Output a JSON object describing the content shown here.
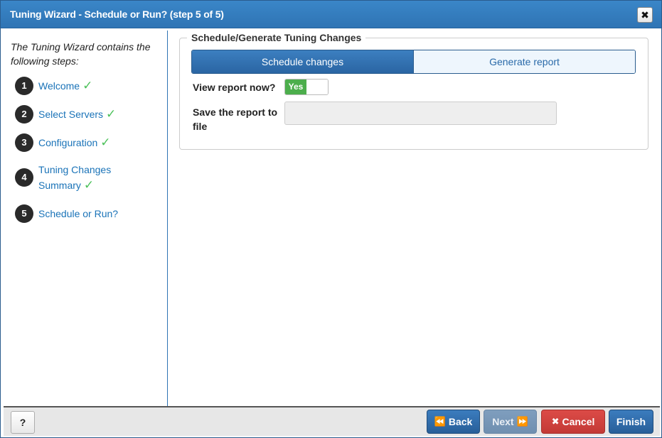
{
  "window": {
    "title": "Tuning Wizard - Schedule or Run? (step 5 of 5)",
    "close_icon": "close-icon",
    "close_glyph": "✖"
  },
  "sidebar": {
    "intro": "The Tuning Wizard contains the following steps:",
    "steps": [
      {
        "number": "1",
        "label": "Welcome",
        "check": "✓"
      },
      {
        "number": "2",
        "label": "Select Servers",
        "check": "✓"
      },
      {
        "number": "3",
        "label": "Configuration",
        "check": "✓"
      },
      {
        "number": "4",
        "label_line1": "Tuning Changes",
        "label_line2": "Summary",
        "check": "✓"
      },
      {
        "number": "5",
        "label": "Schedule or Run?"
      }
    ]
  },
  "main": {
    "legend": "Schedule/Generate Tuning Changes",
    "segments": [
      {
        "label": "Schedule changes",
        "active": true
      },
      {
        "label": "Generate report",
        "active": false
      }
    ],
    "view_report_label": "View report now?",
    "view_report_toggle": "Yes",
    "save_report_label_line1": "Save the report to",
    "save_report_label_line2": "file",
    "save_report_value": ""
  },
  "footer": {
    "help_label": "?",
    "back_label": "Back",
    "back_icon": "⏪",
    "next_label": "Next",
    "next_icon": "⏩",
    "cancel_label": "Cancel",
    "cancel_icon": "✖",
    "finish_label": "Finish"
  },
  "colors": {
    "titlebar": "#2f74b4",
    "link": "#1a73b8",
    "check": "#4cc15a",
    "toggle_on": "#4cae4c",
    "cancel": "#c33a36"
  }
}
